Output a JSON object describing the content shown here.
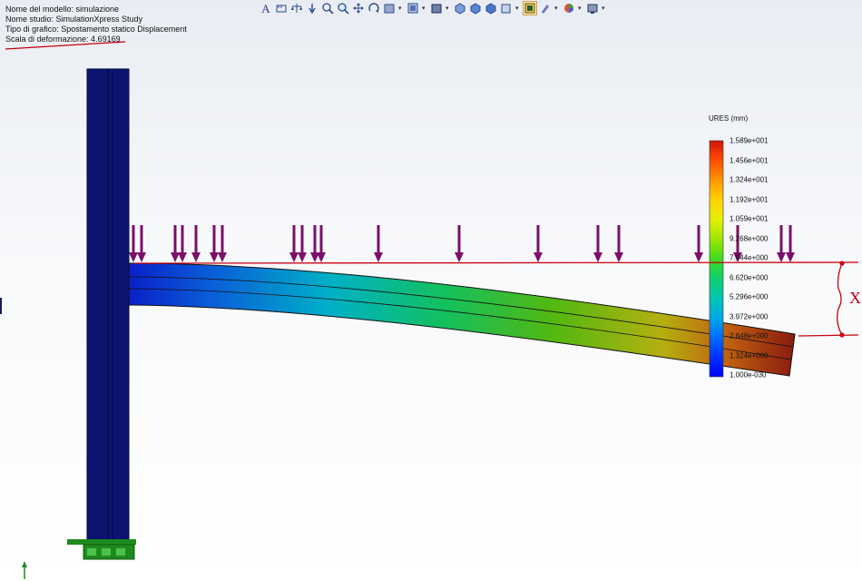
{
  "info": {
    "model_name": "Nome del modello: simulazione",
    "study_name": "Nome studio: SimulationXpress Study",
    "plot_type": "Tipo di grafico: Spostamento statico Displacement",
    "deformation_scale": "Scala di deformazione: 4.69169"
  },
  "toolbar": {
    "icons": [
      "text-icon",
      "measure-icon",
      "scale-icon",
      "probe-icon",
      "zoom-fit-icon",
      "zoom-area-icon",
      "pan-icon",
      "rotate-icon",
      "section-icon",
      "view-orientation-icon",
      "display-style-icon",
      "iso-view-icon",
      "front-view-icon",
      "top-view-icon",
      "right-view-icon",
      "results-plot-icon",
      "edit-appearance-icon",
      "scene-icon",
      "render-settings-icon"
    ]
  },
  "legend": {
    "title": "URES (mm)",
    "labels": [
      "1.589e+001",
      "1.456e+001",
      "1.324e+001",
      "1.192e+001",
      "1.059e+001",
      "9.268e+000",
      "7.944e+000",
      "6.620e+000",
      "5.296e+000",
      "3.972e+000",
      "2.648e+000",
      "1.324e+000",
      "1.000e-030"
    ],
    "colors": [
      "#d2150a",
      "#ff4a00",
      "#ff9a00",
      "#ffd000",
      "#e6f000",
      "#9be600",
      "#3fdc1e",
      "#10d06a",
      "#00c6b4",
      "#00a8e8",
      "#006eff",
      "#0030ff",
      "#0000ff"
    ]
  },
  "annotation": {
    "label": "X"
  },
  "colors": {
    "column": "#0c1470",
    "load_arrow": "#7b0f6b",
    "markup": "#c8000f",
    "fixture": "#1e8a1e"
  }
}
